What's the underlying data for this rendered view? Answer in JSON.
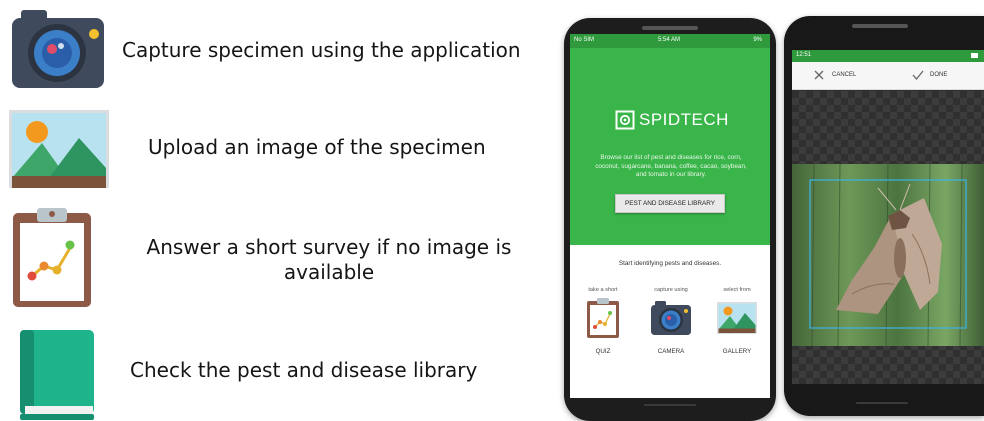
{
  "features": [
    {
      "icon": "camera-icon",
      "text": "Capture specimen using the application"
    },
    {
      "icon": "image-icon",
      "text": "Upload an image of the specimen"
    },
    {
      "icon": "clipboard-chart-icon",
      "text": "Answer a short survey if no image is available"
    },
    {
      "icon": "book-icon",
      "text": "Check the pest and disease library"
    }
  ],
  "phone1": {
    "status_left": "No SIM",
    "status_center": "5:54 AM",
    "status_right": "9%",
    "brand": "SPIDTECH",
    "description": "Browse our list of pest and diseases for rice, corn, coconut, sugarcane, banana, coffee, cacao, soybean, and tomato in our library.",
    "library_button": "PEST AND DISEASE LIBRARY",
    "start_text": "Start identifying pests and diseases.",
    "options": [
      {
        "caption": "take a short",
        "label": "QUIZ",
        "icon": "quiz-clipboard-icon"
      },
      {
        "caption": "capture using",
        "label": "CAMERA",
        "icon": "camera-icon"
      },
      {
        "caption": "select from",
        "label": "GALLERY",
        "icon": "gallery-icon"
      }
    ]
  },
  "phone2": {
    "status_left": "12:51",
    "cancel_label": "CANCEL",
    "done_label": "DONE"
  },
  "colors": {
    "app_green": "#3ab54a",
    "status_green": "#2e9a3c",
    "crop_box": "#3ab4e6",
    "book_teal": "#1fb38c",
    "camera_body": "#3f4a5c",
    "clipboard_brown": "#8e5a48"
  }
}
